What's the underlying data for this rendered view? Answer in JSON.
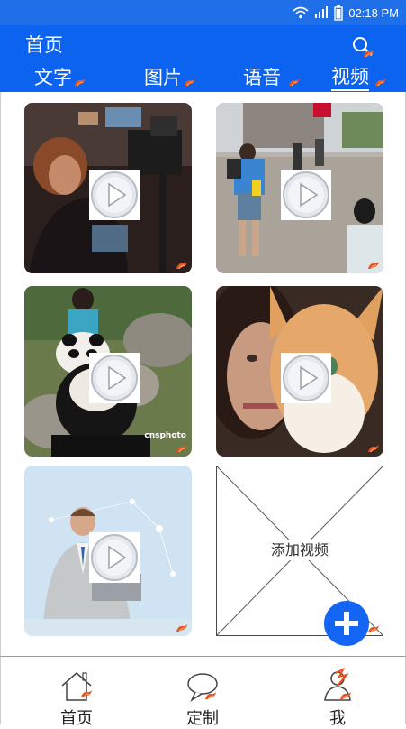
{
  "status_bar": {
    "time": "02:18 PM",
    "icons": [
      "wifi-icon",
      "signal-icon",
      "battery-icon"
    ]
  },
  "header": {
    "title": "首页",
    "search_icon": "search-icon"
  },
  "tabs": [
    {
      "label": "文字",
      "active": false
    },
    {
      "label": "图片",
      "active": false
    },
    {
      "label": "语音",
      "active": false
    },
    {
      "label": "视频",
      "active": true
    }
  ],
  "videos": [
    {
      "subject": "camera operator",
      "icon": "play-icon"
    },
    {
      "subject": "street tourists",
      "icon": "play-icon"
    },
    {
      "subject": "panda with keeper",
      "icon": "play-icon",
      "watermark": "cnsphoto"
    },
    {
      "subject": "woman with cat",
      "icon": "play-icon"
    },
    {
      "subject": "businessman with laptop",
      "icon": "play-icon"
    }
  ],
  "add_video": {
    "label": "添加视频",
    "fab_icon": "plus-icon"
  },
  "bottom_nav": [
    {
      "label": "首页",
      "icon": "home-icon"
    },
    {
      "label": "定制",
      "icon": "chat-bubble-icon"
    },
    {
      "label": "我",
      "icon": "user-icon"
    }
  ],
  "colors": {
    "primary": "#0b63f0",
    "status_bar": "#1f6fe8",
    "accent_flame": "#e8541c",
    "fab": "#1565f5"
  }
}
